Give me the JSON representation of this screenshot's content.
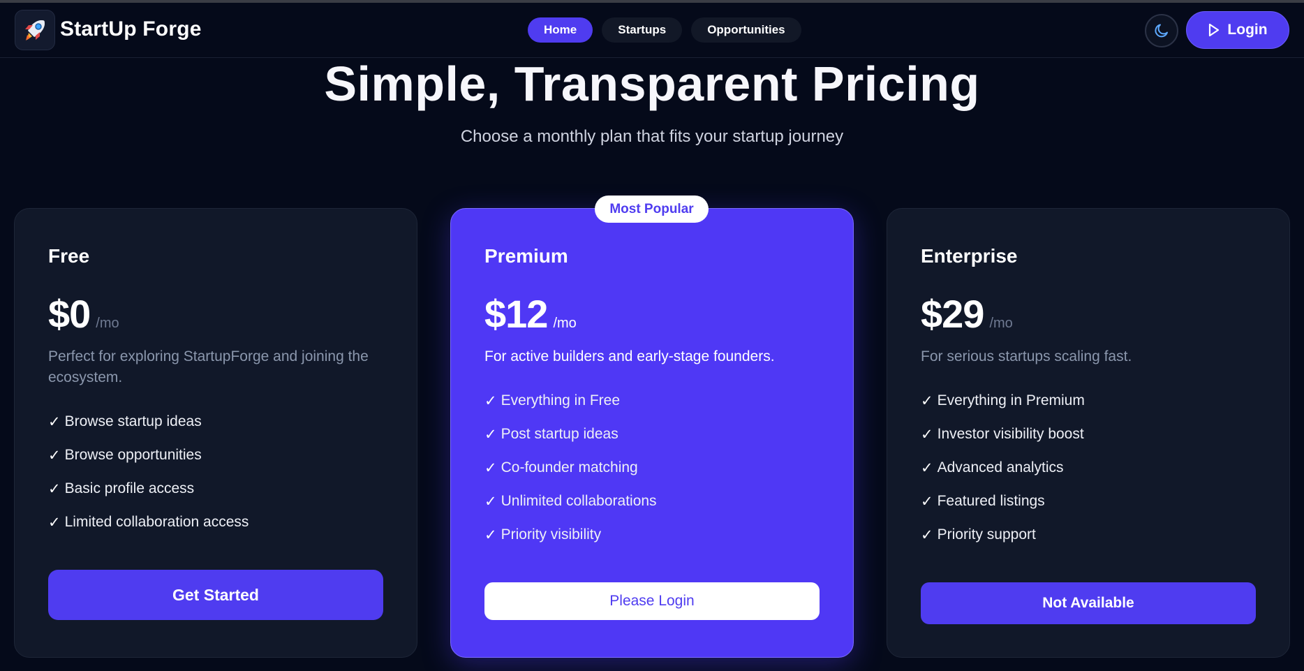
{
  "header": {
    "brand": "StartUp Forge",
    "logo_icon": "rocket-icon",
    "nav": [
      {
        "label": "Home",
        "active": true
      },
      {
        "label": "Startups",
        "active": false
      },
      {
        "label": "Opportunities",
        "active": false
      }
    ],
    "theme_icon": "moon-icon",
    "login_label": "Login",
    "login_icon": "play-icon"
  },
  "hero": {
    "title": "Simple, Transparent Pricing",
    "subtitle": "Choose a monthly plan that fits your startup journey"
  },
  "colors": {
    "accent": "#4f3cf0",
    "background": "#050a1a",
    "card": "#111829"
  },
  "plans": [
    {
      "name": "Free",
      "price": "$0",
      "period": "/mo",
      "description": "Perfect for exploring StartupForge and joining the ecosystem.",
      "features": [
        "Browse startup ideas",
        "Browse opportunities",
        "Basic profile access",
        "Limited collaboration access"
      ],
      "cta": "Get Started"
    },
    {
      "name": "Premium",
      "badge": "Most Popular",
      "price": "$12",
      "period": "/mo",
      "description": "For active builders and early-stage founders.",
      "features": [
        "Everything in Free",
        "Post startup ideas",
        "Co-founder matching",
        "Unlimited collaborations",
        "Priority visibility"
      ],
      "cta": "Please Login"
    },
    {
      "name": "Enterprise",
      "price": "$29",
      "period": "/mo",
      "description": "For serious startups scaling fast.",
      "features": [
        "Everything in Premium",
        "Investor visibility boost",
        "Advanced analytics",
        "Featured listings",
        "Priority support"
      ],
      "cta": "Not Available"
    }
  ],
  "check_glyph": "✓"
}
